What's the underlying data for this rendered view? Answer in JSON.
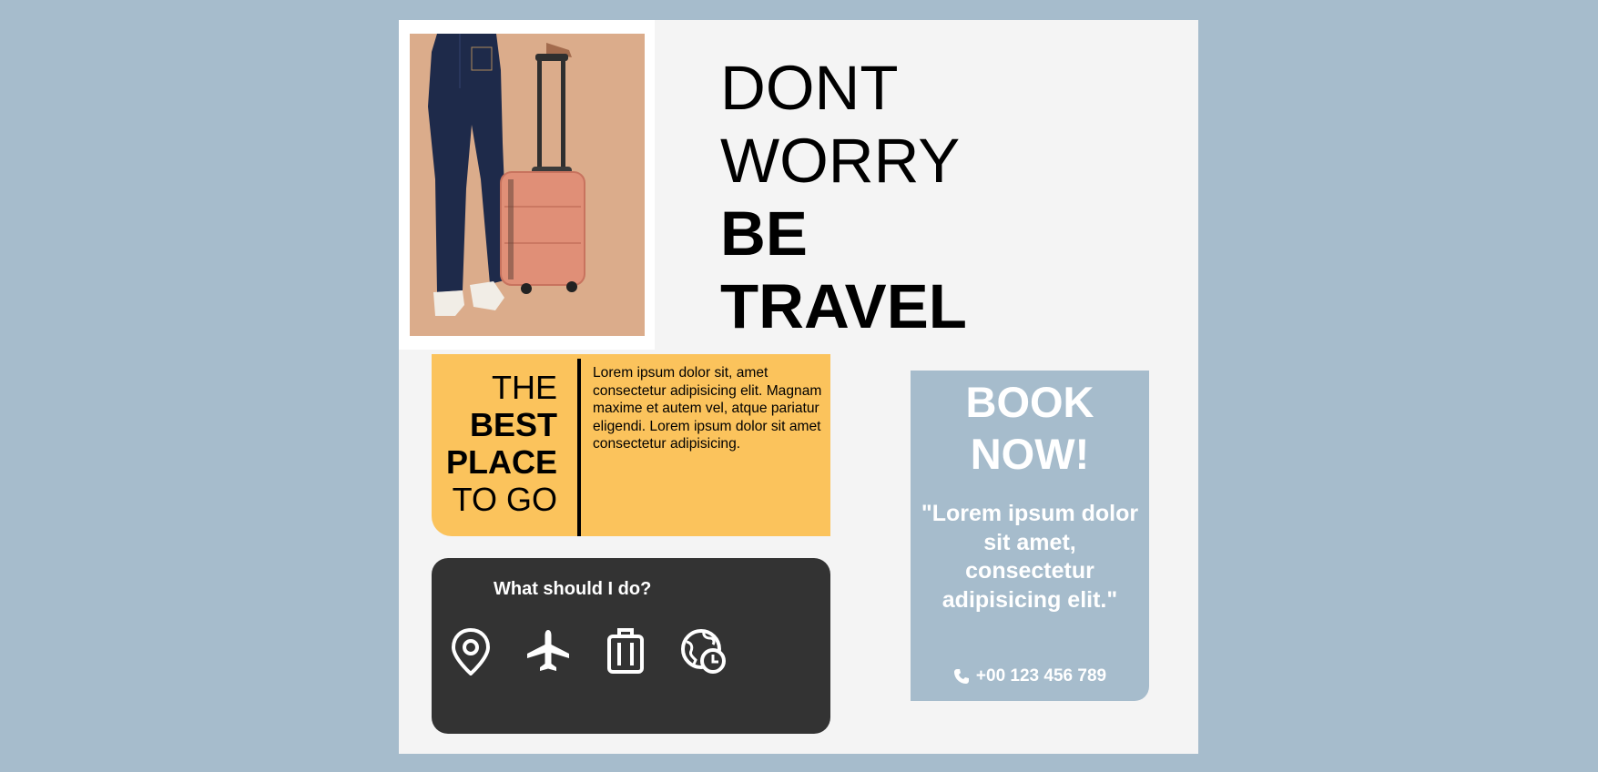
{
  "headline": {
    "line1": "DONT",
    "line2": "WORRY",
    "line3": "BE",
    "line4": "TRAVEL"
  },
  "best_place": {
    "line1": "THE",
    "line2": "BEST",
    "line3": "PLACE",
    "line4": "TO GO"
  },
  "yellow_card_text": "Lorem ipsum dolor sit, amet consectetur adipisicing elit. Magnam maxime et autem vel, atque pariatur eligendi. Lorem ipsum dolor sit amet consectetur adipisicing.",
  "activities": {
    "title": "What should I do?",
    "icons": [
      "map-pin-icon",
      "airplane-icon",
      "suitcase-icon",
      "globe-clock-icon"
    ]
  },
  "book": {
    "line1": "BOOK",
    "line2": "NOW!",
    "quote": "\"Lorem ipsum dolor sit amet, consectetur adipisicing elit.\"",
    "phone": "+00 123 456 789",
    "phone_icon": "phone-icon"
  },
  "colors": {
    "background": "#a6bccc",
    "poster": "#f4f4f4",
    "yellow": "#fbc35c",
    "dark": "#333333",
    "blue": "#a6bccc"
  }
}
